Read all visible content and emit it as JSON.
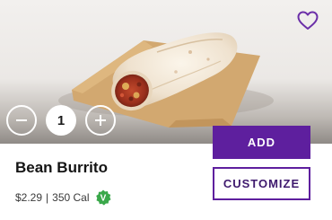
{
  "product": {
    "name": "Bean Burrito",
    "price": "$2.29",
    "separator": "|",
    "calories": "350 Cal",
    "badge_letter": "V"
  },
  "quantity": {
    "value": "1"
  },
  "actions": {
    "add_label": "ADD",
    "customize_label": "CUSTOMIZE"
  },
  "icons": {
    "favorite": "heart-outline-icon",
    "decrement": "minus-icon",
    "increment": "plus-icon",
    "vegetarian": "vegetarian-badge-icon"
  },
  "colors": {
    "brand_purple": "#5e1f9e",
    "badge_green": "#3aa84a",
    "favorite_purple": "#6b2fa8"
  }
}
